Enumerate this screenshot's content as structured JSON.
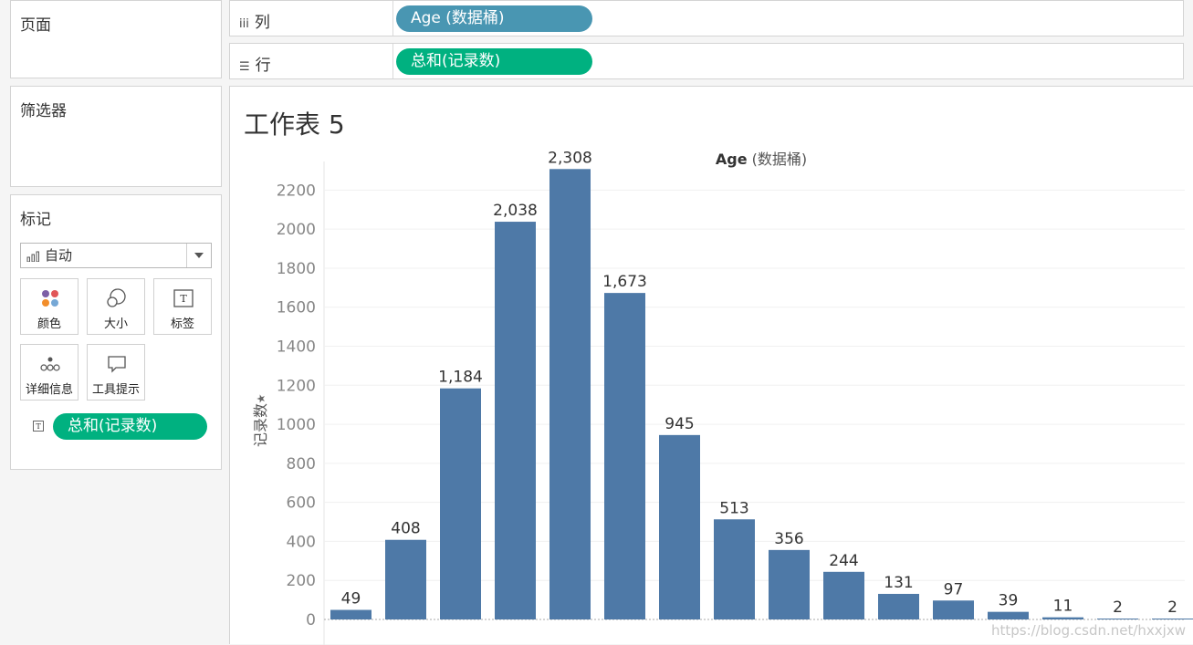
{
  "left_panel": {
    "pages_title": "页面",
    "filters_title": "筛选器",
    "marks_title": "标记",
    "mark_type": "自动",
    "mark_buttons": [
      {
        "label": "颜色",
        "icon": "color-icon"
      },
      {
        "label": "大小",
        "icon": "size-icon"
      },
      {
        "label": "标签",
        "icon": "label-icon"
      },
      {
        "label": "详细信息",
        "icon": "detail-icon"
      },
      {
        "label": "工具提示",
        "icon": "tooltip-icon"
      }
    ],
    "mark_pill": "总和(记录数)"
  },
  "shelves": {
    "columns_label": "列",
    "columns_pill": "Age (数据桶)",
    "rows_label": "行",
    "rows_pill": "总和(记录数)"
  },
  "sheet": {
    "title": "工作表 5"
  },
  "colors": {
    "bar": "#4e79a7",
    "pill_green": "#00b180",
    "pill_blue": "#4996b2"
  },
  "watermark": "https://blog.csdn.net/hxxjxw",
  "chart_data": {
    "type": "bar",
    "title": "",
    "xlabel_bold": "Age",
    "xlabel_rest": " (数据桶)",
    "ylabel": "记录数",
    "ylim": [
      0,
      2300
    ],
    "yticks": [
      0,
      200,
      400,
      600,
      800,
      1000,
      1200,
      1400,
      1600,
      1800,
      2000,
      2200
    ],
    "yticks_labels": [
      "0",
      "200",
      "400",
      "600",
      "800",
      "1000",
      "1200",
      "1400",
      "1600",
      "1800",
      "2000",
      "2200"
    ],
    "values": [
      49,
      408,
      1184,
      2038,
      2308,
      1673,
      945,
      513,
      356,
      244,
      131,
      97,
      39,
      11,
      2,
      2
    ],
    "value_labels": [
      "49",
      "408",
      "1,184",
      "2,038",
      "2,308",
      "1,673",
      "945",
      "513",
      "356",
      "244",
      "131",
      "97",
      "39",
      "11",
      "2",
      "2"
    ],
    "grid": true
  }
}
